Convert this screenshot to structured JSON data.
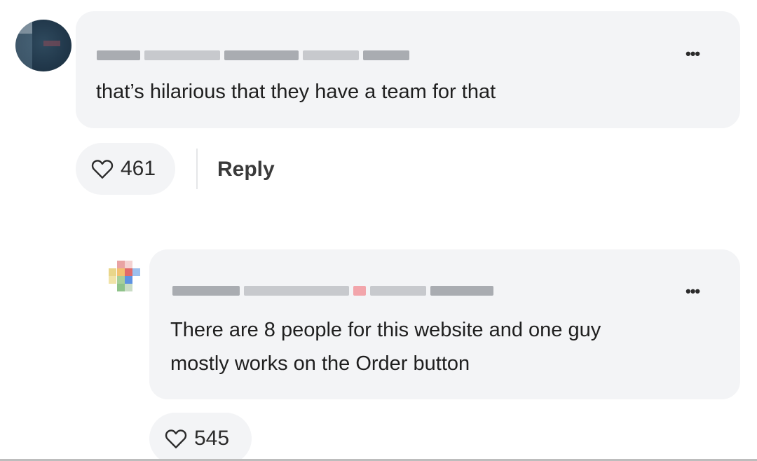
{
  "comments": [
    {
      "text": "that’s hilarious that they have a team for that",
      "likes": "461",
      "reply_label": "Reply",
      "more_label": "•••"
    },
    {
      "text_line1": "There are 8 people for this website and one guy",
      "text_line2": "mostly works on the Order button",
      "likes": "545",
      "more_label": "•••"
    }
  ],
  "icons": {
    "like": "heart-outline-icon",
    "more": "more-horizontal-icon"
  },
  "colors": {
    "bubble_bg": "#f3f4f6",
    "text": "#1f1f1f",
    "pixelated_flag": "#f2a5ab"
  }
}
